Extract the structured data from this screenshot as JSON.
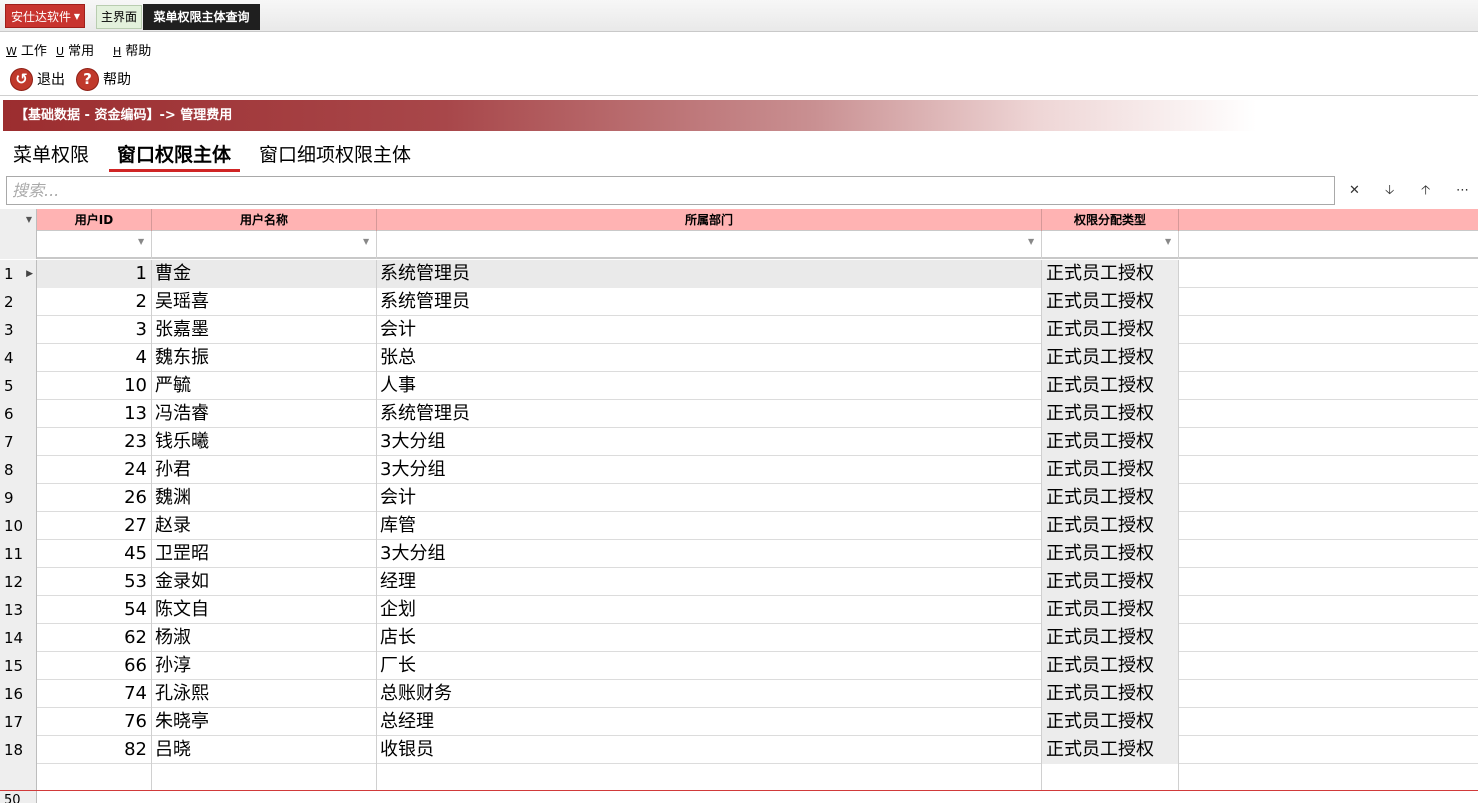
{
  "titlebar": {
    "app_menu": "安仕达软件",
    "tabs": [
      {
        "label": "主界面"
      },
      {
        "label": "菜单权限主体查询"
      }
    ]
  },
  "menubar": {
    "items": [
      {
        "key": "W",
        "label": "工作"
      },
      {
        "key": "U",
        "label": "常用"
      },
      {
        "key": "H",
        "label": "帮助"
      }
    ]
  },
  "toolbar": {
    "exit_label": "退出",
    "help_label": "帮助"
  },
  "breadcrumb": "【基础数据 - 资金编码】-> 管理费用",
  "content_tabs": [
    {
      "label": "菜单权限"
    },
    {
      "label": "窗口权限主体"
    },
    {
      "label": "窗口细项权限主体"
    }
  ],
  "search": {
    "placeholder": "搜索..."
  },
  "grid": {
    "columns": [
      "用户ID",
      "用户名称",
      "所属部门",
      "权限分配类型"
    ],
    "rows": [
      {
        "n": "1",
        "id": "1",
        "name": "曹金",
        "dept": "系统管理员",
        "type": "正式员工授权"
      },
      {
        "n": "2",
        "id": "2",
        "name": "吴瑶喜",
        "dept": "系统管理员",
        "type": "正式员工授权"
      },
      {
        "n": "3",
        "id": "3",
        "name": "张嘉墨",
        "dept": "会计",
        "type": "正式员工授权"
      },
      {
        "n": "4",
        "id": "4",
        "name": "魏东振",
        "dept": "张总",
        "type": "正式员工授权"
      },
      {
        "n": "5",
        "id": "10",
        "name": "严毓",
        "dept": "人事",
        "type": "正式员工授权"
      },
      {
        "n": "6",
        "id": "13",
        "name": "冯浩睿",
        "dept": "系统管理员",
        "type": "正式员工授权"
      },
      {
        "n": "7",
        "id": "23",
        "name": "钱乐曦",
        "dept": "3大分组",
        "type": "正式员工授权"
      },
      {
        "n": "8",
        "id": "24",
        "name": "孙君",
        "dept": "3大分组",
        "type": "正式员工授权"
      },
      {
        "n": "9",
        "id": "26",
        "name": "魏渊",
        "dept": "会计",
        "type": "正式员工授权"
      },
      {
        "n": "10",
        "id": "27",
        "name": "赵录",
        "dept": "库管",
        "type": "正式员工授权"
      },
      {
        "n": "11",
        "id": "45",
        "name": "卫罡昭",
        "dept": "3大分组",
        "type": "正式员工授权"
      },
      {
        "n": "12",
        "id": "53",
        "name": "金录如",
        "dept": "经理",
        "type": "正式员工授权"
      },
      {
        "n": "13",
        "id": "54",
        "name": "陈文自",
        "dept": "企划",
        "type": "正式员工授权"
      },
      {
        "n": "14",
        "id": "62",
        "name": "杨淑",
        "dept": "店长",
        "type": "正式员工授权"
      },
      {
        "n": "15",
        "id": "66",
        "name": "孙淳",
        "dept": "厂长",
        "type": "正式员工授权"
      },
      {
        "n": "16",
        "id": "74",
        "name": "孔泳熙",
        "dept": "总账财务",
        "type": "正式员工授权"
      },
      {
        "n": "17",
        "id": "76",
        "name": "朱晓亭",
        "dept": "总经理",
        "type": "正式员工授权"
      },
      {
        "n": "18",
        "id": "82",
        "name": "吕晓",
        "dept": "收银员",
        "type": "正式员工授权"
      }
    ],
    "footer_count": "50"
  }
}
